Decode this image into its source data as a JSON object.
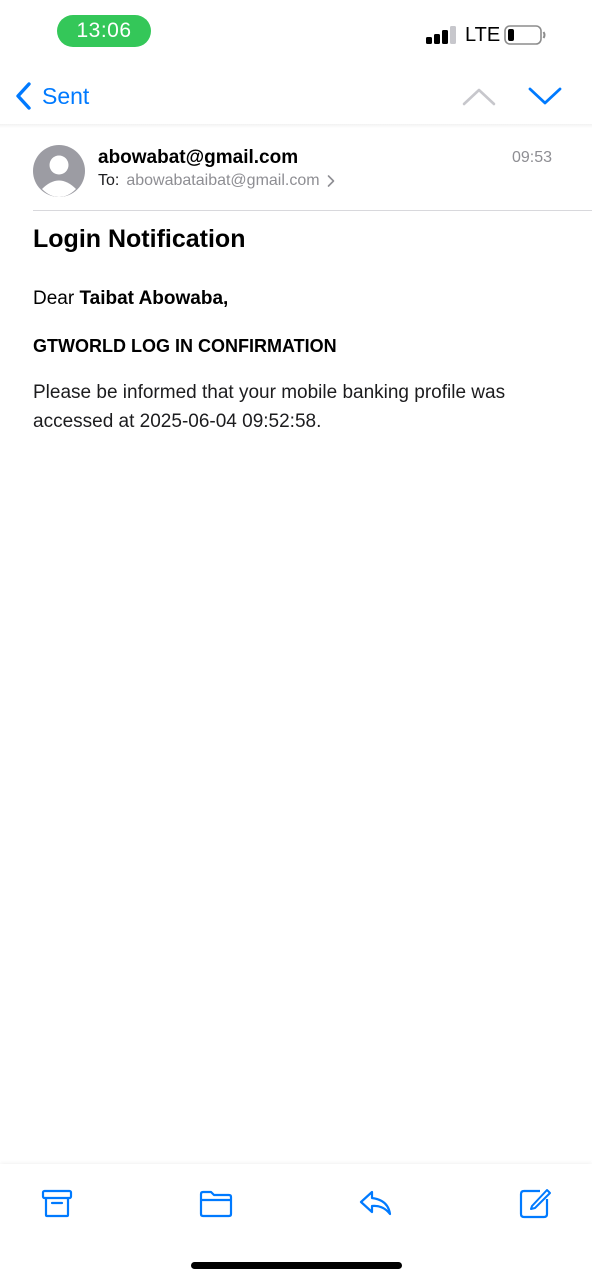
{
  "status_bar": {
    "time": "13:06",
    "network": "LTE"
  },
  "nav": {
    "back_label": "Sent",
    "icons": [
      "chevron-left-icon",
      "chevron-up-icon",
      "chevron-down-icon"
    ]
  },
  "email": {
    "from": "abowabat@gmail.com",
    "to_prefix": "To:",
    "to": "abowabataibat@gmail.com",
    "time": "09:53",
    "subject": "Login Notification",
    "greeting_prefix": "Dear ",
    "greeting_name": "Taibat Abowaba,",
    "heading": "GTWORLD LOG IN CONFIRMATION",
    "paragraph": "Please be informed that your mobile banking profile was accessed at 2025-06-04 09:52:58."
  },
  "toolbar": {
    "icons": [
      "archive-icon",
      "folder-icon",
      "reply-icon",
      "compose-icon"
    ]
  },
  "colors": {
    "accent": "#007aff",
    "time_pill": "#34c759",
    "secondary_text": "#8e8e93"
  }
}
